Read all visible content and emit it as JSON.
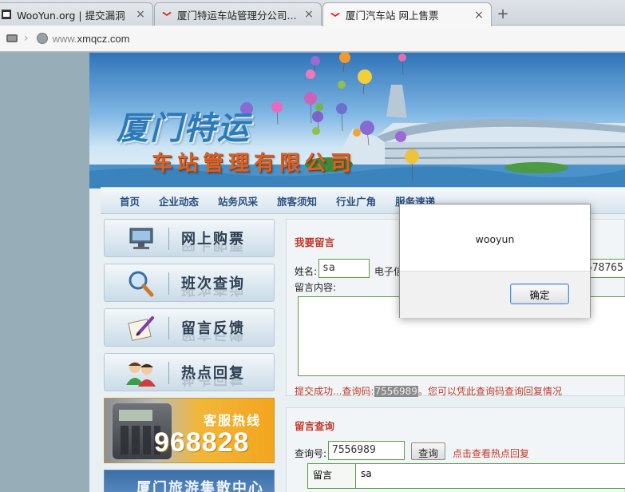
{
  "browser": {
    "tabs": [
      {
        "title": "WooYun.org | 提交漏洞",
        "favicon": "wooyun-icon",
        "active": false
      },
      {
        "title": "厦门特运车站管理分公司...",
        "favicon": "xmqcz-icon",
        "active": false
      },
      {
        "title": "厦门汽车站 网上售票",
        "favicon": "xmqcz-icon",
        "active": true
      }
    ],
    "new_tab_symbol": "+",
    "close_symbol": "×",
    "url_prefix": "www.",
    "url_domain": "xmqcz.com"
  },
  "site": {
    "banner": {
      "title": "厦门特运",
      "subtitle": "车站管理有限公司"
    },
    "nav": [
      "首页",
      "企业动态",
      "站务风采",
      "旅客须知",
      "行业广角",
      "服务速递"
    ],
    "side_menu": [
      {
        "label": "网上购票",
        "icon": "monitor-icon"
      },
      {
        "label": "班次查询",
        "icon": "magnifier-icon"
      },
      {
        "label": "留言反馈",
        "icon": "quill-icon"
      },
      {
        "label": "热点回复",
        "icon": "users-icon"
      }
    ],
    "hotline": {
      "title": "客服热线",
      "number": "968828"
    },
    "promo": "厦门旅游集散中心"
  },
  "message_form": {
    "title": "我要留言",
    "name_label": "姓名:",
    "name_value": "sa",
    "email_label": "电子信",
    "email_value": "578765",
    "content_label": "留言内容:",
    "success_prefix": "提交成功...查询码:",
    "success_code": "7556989",
    "success_suffix": "。您可以凭此查询码查询回复情况"
  },
  "query": {
    "title": "留言查询",
    "label": "查询号:",
    "value": "7556989",
    "button": "查询",
    "hot_link": "点击查看热点回复",
    "result_label": "留言",
    "result_value": "sa"
  },
  "dialog": {
    "message": "wooyun",
    "ok_label": "确定"
  },
  "colors": {
    "accent_red": "#c0392b",
    "nav_blue": "#2b4f7e",
    "field_green": "#5a9a4a",
    "dialog_focus": "#4d90d6"
  }
}
